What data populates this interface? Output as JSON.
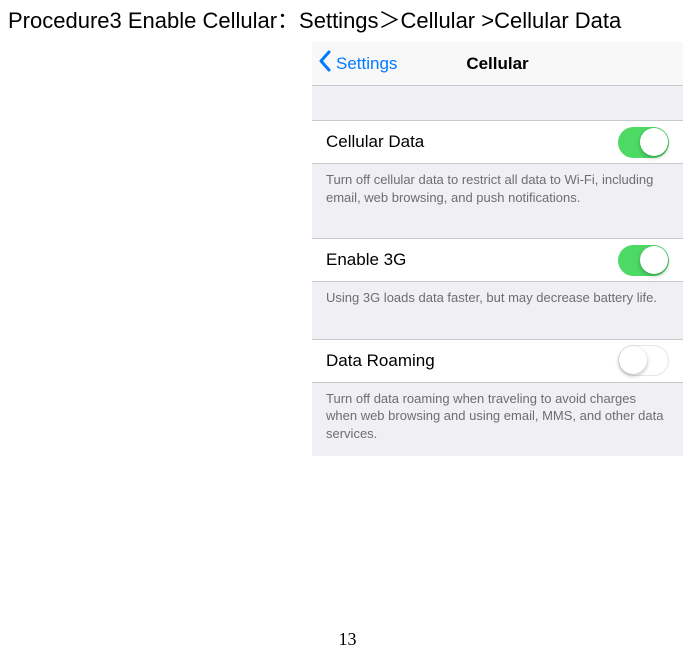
{
  "document": {
    "heading": "Procedure3 Enable Cellular：Settings＞Cellular >Cellular Data",
    "page_number": "13"
  },
  "navbar": {
    "back_label": "Settings",
    "title": "Cellular"
  },
  "sections": [
    {
      "label": "Cellular Data",
      "toggle_on": true,
      "footer": "Turn off cellular data to restrict all data to Wi-Fi, including email, web browsing, and push notifications."
    },
    {
      "label": "Enable 3G",
      "toggle_on": true,
      "footer": "Using 3G loads data faster, but may decrease battery life."
    },
    {
      "label": "Data Roaming",
      "toggle_on": false,
      "footer": "Turn off data roaming when traveling to avoid charges when web browsing and using email, MMS, and other data services."
    }
  ]
}
